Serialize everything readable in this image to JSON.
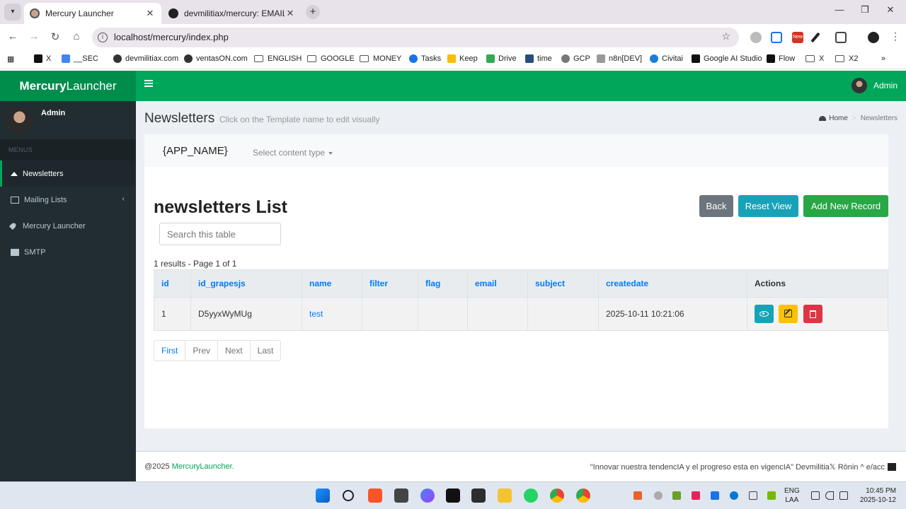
{
  "browser": {
    "tabs": [
      {
        "title": "Mercury Launcher",
        "active": true
      },
      {
        "title": "devmilitiax/mercury: EMAIL BU",
        "active": false
      }
    ],
    "url": "localhost/mercury/index.php",
    "bookmarks": [
      "X",
      "__SEC",
      "devmilitiax.com",
      "ventasON.com",
      "ENGLISH",
      "GOOGLE",
      "MONEY",
      "Tasks",
      "Keep",
      "Drive",
      "time",
      "GCP",
      "n8n[DEV]",
      "Civitai",
      "Google AI Studio",
      "Flow",
      "X",
      "X2"
    ],
    "extension_badge": "New"
  },
  "header": {
    "logo_bold": "Mercury",
    "logo_rest": "Launcher",
    "user": "Admin"
  },
  "sidebar": {
    "user": "Admin",
    "menu_header": "MENUS",
    "items": [
      {
        "label": "Newsletters",
        "icon": "home-icon",
        "active": true
      },
      {
        "label": "Mailing Lists",
        "icon": "list-icon",
        "active": false
      },
      {
        "label": "Mercury Launcher",
        "icon": "rocket-icon",
        "active": false
      },
      {
        "label": "SMTP",
        "icon": "envelope-icon",
        "active": false
      }
    ]
  },
  "page": {
    "title": "Newsletters",
    "subtitle": "Click on the Template name to edit visually",
    "breadcrumb": [
      "Home",
      "Newsletters"
    ]
  },
  "subnav": {
    "app_name": "{APP_NAME}",
    "content_type": "Select content type"
  },
  "list": {
    "title": "newsletters List",
    "buttons": {
      "back": "Back",
      "reset": "Reset View",
      "add": "Add New Record"
    },
    "search_placeholder": "Search this table",
    "results_text": "1 results - Page 1 of 1",
    "columns": [
      "id",
      "id_grapesjs",
      "name",
      "filter",
      "flag",
      "email",
      "subject",
      "createdate",
      "Actions"
    ],
    "rows": [
      {
        "id": "1",
        "id_grapesjs": "D5yyxWyMUg",
        "name": "test",
        "filter": "",
        "flag": "",
        "email": "",
        "subject": "",
        "createdate": "2025-10-11 10:21:06"
      }
    ],
    "pagination": [
      "First",
      "Prev",
      "Next",
      "Last"
    ]
  },
  "footer": {
    "copyright": "@2025",
    "brand": "MercuryLauncher.",
    "quote": "\"Innovar nuestra tendencIA y el progreso esta en vigencIA\" Devmilitia𝕏 Rōnin ^ e/acc"
  },
  "taskbar": {
    "lang_1": "ENG",
    "lang_2": "LAA",
    "time": "10:45 PM",
    "date": "2025-10-12"
  },
  "colors": {
    "primary_green": "#00a65a",
    "sidebar_dark": "#222d32",
    "link_blue": "#007bff",
    "info": "#17a2b8",
    "warning": "#ffc107",
    "danger": "#dc3545",
    "success": "#28a745",
    "secondary": "#6c757d"
  }
}
